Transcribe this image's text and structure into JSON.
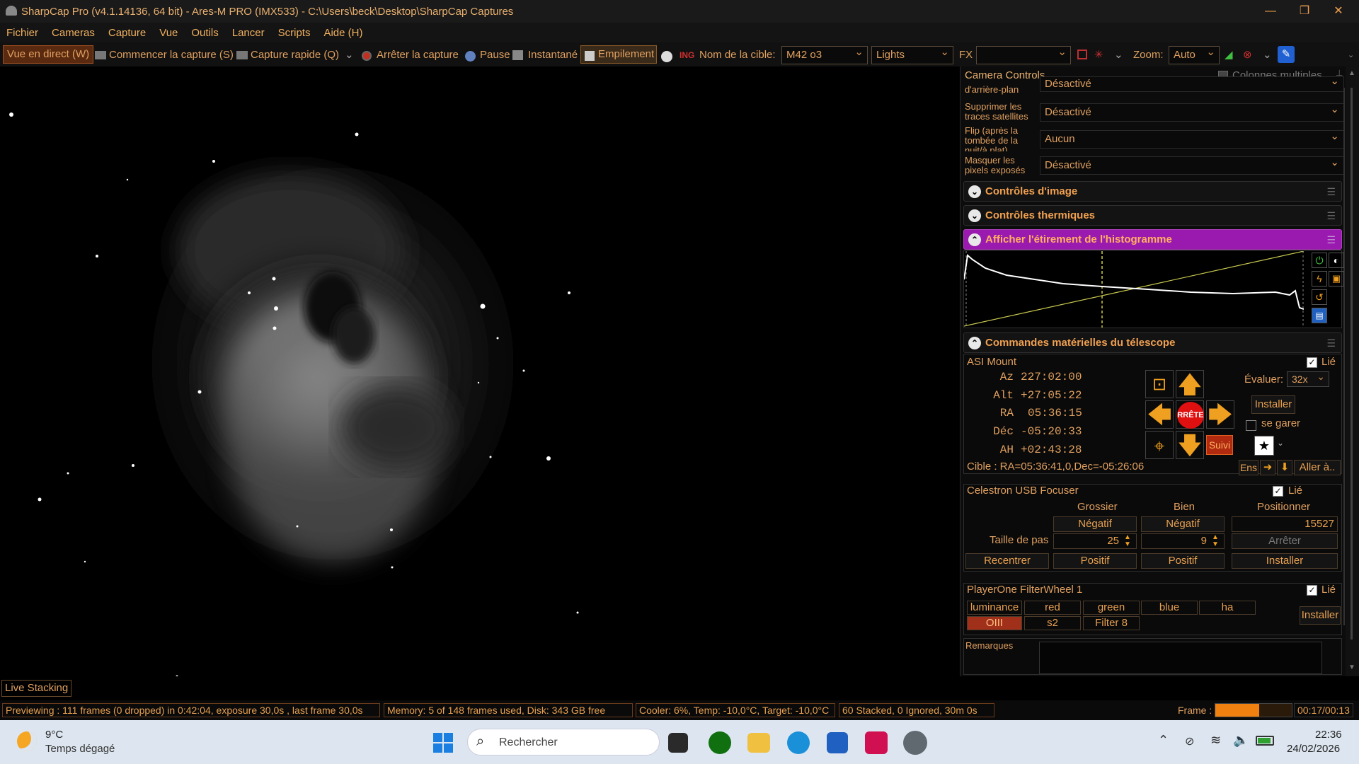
{
  "window": {
    "title": "SharpCap Pro (v4.1.14136, 64 bit) - Ares-M PRO (IMX533) - C:\\Users\\beck\\Desktop\\SharpCap Captures",
    "minimize": "—",
    "maximize": "❐",
    "close": "✕"
  },
  "menu": [
    "Fichier",
    "Cameras",
    "Capture",
    "Vue",
    "Outils",
    "Lancer",
    "Scripts",
    "Aide (H)"
  ],
  "toolbar": {
    "live_view": "Vue en direct (W)",
    "start_capture": "Commencer la capture (S)",
    "quick_capture": "Capture rapide (Q)",
    "stop_capture": "Arrêter la capture",
    "pause": "Pause",
    "snapshot": "Instantané",
    "stacking": "Empilement",
    "target_label": "Nom de la cible:",
    "target_value": "M42 o3",
    "frame_type": "Lights",
    "fx_label": "FX",
    "fx_value": "",
    "zoom_label": "Zoom:",
    "zoom_value": "Auto"
  },
  "panel": {
    "header": "Camera Controls",
    "multi_columns": "Colonnes multiples",
    "settings": [
      {
        "label": "d'arrière-plan",
        "value": "Désactivé"
      },
      {
        "label": "Supprimer les traces satellites",
        "value": "Désactivé"
      },
      {
        "label": "Flip (après la tombée de la nuit/à plat)",
        "value": "Aucun"
      },
      {
        "label": "Masquer les pixels exposés",
        "value": "Désactivé"
      }
    ],
    "sections": {
      "image_controls": "Contrôles d'image",
      "thermal_controls": "Contrôles thermiques",
      "histogram": "Afficher l'étirement de l'histogramme",
      "telescope": "Commandes matérielles du télescope"
    },
    "mount": {
      "name": "ASI Mount",
      "linked": "Lié",
      "coords": [
        {
          "k": "Az",
          "v": "227:02:00"
        },
        {
          "k": "Alt",
          "v": "+27:05:22"
        },
        {
          "k": "RA",
          "v": "05:36:15"
        },
        {
          "k": "Déc",
          "v": "-05:20:33"
        },
        {
          "k": "AH",
          "v": "+02:43:28"
        }
      ],
      "stop": "RRÊTE",
      "rate_label": "Évaluer:",
      "rate_value": "32x",
      "install": "Installer",
      "park": "se garer",
      "track": "Suivi",
      "target": "Cible : RA=05:36:41,0,Dec=-05:26:06",
      "ens": "Ens",
      "goto": "Aller à.."
    },
    "focuser": {
      "name": "Celestron USB Focuser",
      "linked": "Lié",
      "col_coarse": "Grossier",
      "col_fine": "Bien",
      "col_pos": "Positionner",
      "neg": "Négatif",
      "pos": "Positif",
      "position": "15527",
      "step_label": "Taille de pas",
      "coarse_step": "25",
      "fine_step": "9",
      "stop": "Arrêter",
      "recenter": "Recentrer",
      "install": "Installer"
    },
    "filterwheel": {
      "name": "PlayerOne FilterWheel 1",
      "linked": "Lié",
      "filters": [
        "luminance",
        "red",
        "green",
        "blue",
        "ha",
        "OIII",
        "s2",
        "Filter 8"
      ],
      "selected": "OIII",
      "install": "Installer"
    },
    "notes_label": "Remarques"
  },
  "live_stacking_tab": "Live Stacking",
  "status": {
    "preview": "Previewing : 111 frames (0 dropped) in 0:42:04, exposure 30,0s , last frame 30,0s",
    "memory": "Memory: 5 of 148 frames used, Disk: 343 GB free",
    "cooler": "Cooler: 6%, Temp: -10,0°C, Target: -10,0°C",
    "stack": "60 Stacked, 0 Ignored, 30m 0s",
    "frame_label": "Frame :",
    "frame_progress": 0.57,
    "frame_time": "00:17/00:13"
  },
  "taskbar": {
    "weather_temp": "9°C",
    "weather_desc": "Temps dégagé",
    "search": "Rechercher",
    "time": "22:36",
    "date": "24/02/2026"
  },
  "colors": {
    "accent": "#e8a050",
    "histogram_header": "#9a1ab0",
    "stop_red": "#e01010",
    "arrow_orange": "#f0a020",
    "selected_filter": "#a0301a"
  }
}
